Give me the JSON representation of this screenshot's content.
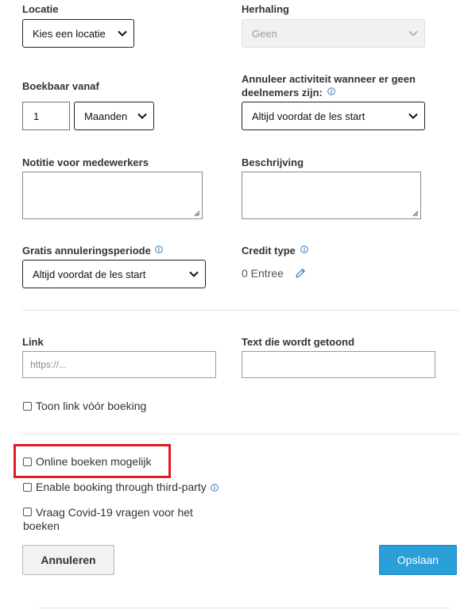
{
  "row1": {
    "location": {
      "label": "Locatie",
      "value": "Kies een locatie"
    },
    "repeat": {
      "label": "Herhaling",
      "value": "Geen"
    }
  },
  "row2": {
    "bookable_from": {
      "label": "Boekbaar vanaf",
      "number": "1",
      "unit": "Maanden"
    },
    "cancel_activity": {
      "label": "Annuleer activiteit wanneer er geen deelnemers zijn:",
      "value": "Altijd voordat de les start"
    }
  },
  "row3": {
    "staff_note": {
      "label": "Notitie voor medewerkers",
      "value": ""
    },
    "description": {
      "label": "Beschrijving",
      "value": ""
    }
  },
  "row4": {
    "free_cancel": {
      "label": "Gratis annuleringsperiode",
      "value": "Altijd voordat de les start"
    },
    "credit_type": {
      "label": "Credit type",
      "value": "0 Entree"
    }
  },
  "row5": {
    "link": {
      "label": "Link",
      "placeholder": "https://..."
    },
    "link_text": {
      "label": "Text die wordt getoond",
      "value": ""
    },
    "show_link_before_booking": {
      "label": "Toon link vóór boeking",
      "checked": false
    }
  },
  "options": {
    "online_booking": {
      "label": "Online boeken mogelijk",
      "checked": false
    },
    "third_party": {
      "label": "Enable booking through third-party",
      "checked": false
    },
    "covid": {
      "label": "Vraag Covid-19 vragen voor het boeken",
      "checked": false
    }
  },
  "actions": {
    "cancel_label": "Annuleren",
    "save_label": "Opslaan"
  },
  "colors": {
    "accent": "#2a9fd8",
    "highlight": "#e01b24",
    "info_icon": "#3a7fc1"
  }
}
